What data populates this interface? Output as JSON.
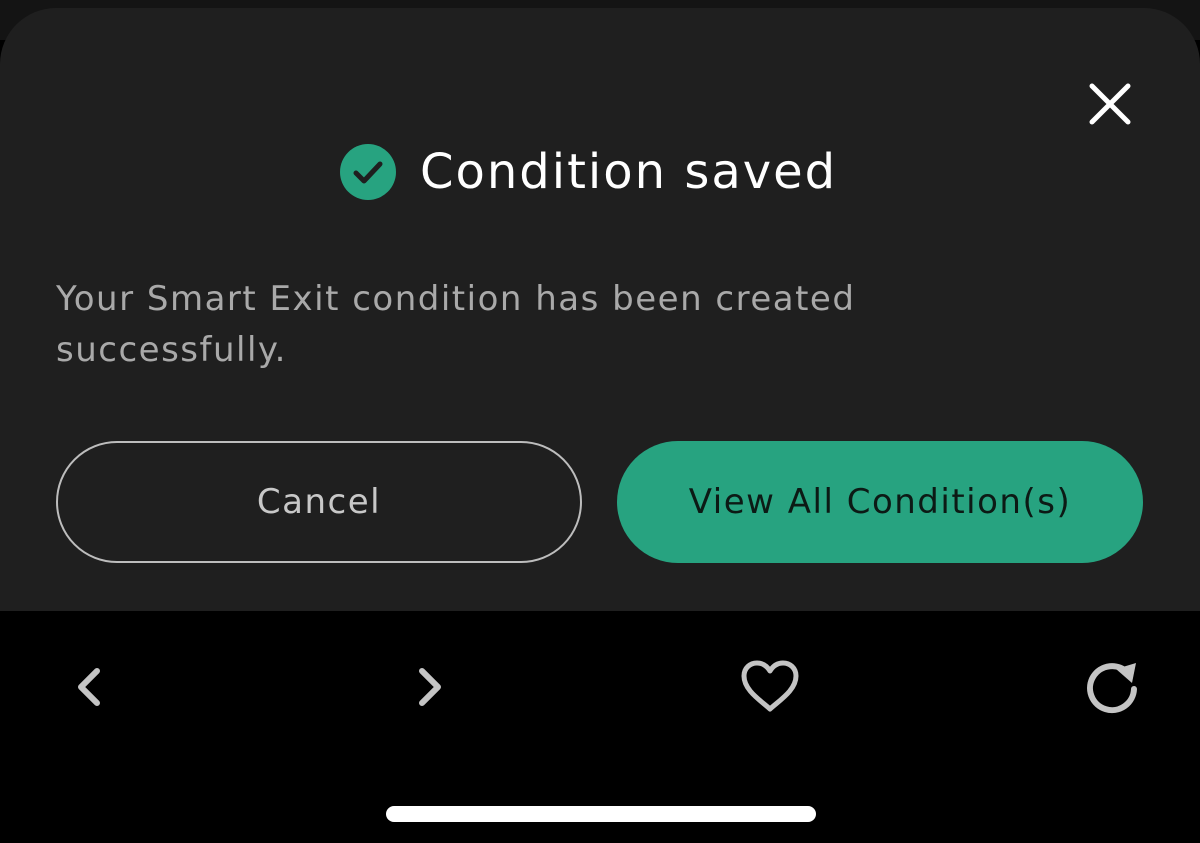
{
  "dialog": {
    "title": "Condition saved",
    "message": "Your Smart Exit condition has been created successfully.",
    "cancel_label": "Cancel",
    "primary_label": "View All Condition(s)",
    "icons": {
      "status": "check-circle-icon",
      "close": "close-icon"
    }
  },
  "browser_toolbar": {
    "icons": [
      "back-chevron-icon",
      "forward-chevron-icon",
      "heart-icon",
      "reload-icon"
    ]
  },
  "colors": {
    "accent": "#27a380",
    "sheet_background": "#1f1f1f",
    "text_primary": "#ffffff",
    "text_secondary": "#a9a9a9"
  }
}
